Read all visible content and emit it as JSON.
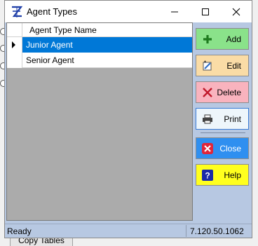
{
  "window": {
    "title": "Agent Types",
    "app_icon": "agent-types-app-icon",
    "controls": [
      "minimize-icon",
      "maximize-icon",
      "close-icon"
    ]
  },
  "grid": {
    "column_header": "Agent Type Name",
    "rows": [
      {
        "name": "Junior Agent",
        "selected": true
      },
      {
        "name": "Senior Agent",
        "selected": false
      }
    ]
  },
  "buttons": {
    "add": {
      "label": "Add",
      "icon": "plus-icon",
      "color": "#8ae28a"
    },
    "edit": {
      "label": "Edit",
      "icon": "edit-icon",
      "color": "#fadca6"
    },
    "delete": {
      "label": "Delete",
      "icon": "delete-x-icon",
      "color": "#f9b3be"
    },
    "print": {
      "label": "Print",
      "icon": "printer-icon",
      "color": "#eef6fb"
    },
    "close": {
      "label": "Close",
      "icon": "close-x-icon",
      "color": "#2f8ff0"
    },
    "help": {
      "label": "Help",
      "icon": "question-icon",
      "color": "#ffff1e"
    }
  },
  "status": {
    "left": "Ready",
    "version": "7.120.50.1062"
  },
  "background": {
    "tab_label": "Copy Tables"
  },
  "colors": {
    "window_bg": "#b7c8e2",
    "selection": "#0078d7",
    "grid_bg": "#ababab"
  }
}
